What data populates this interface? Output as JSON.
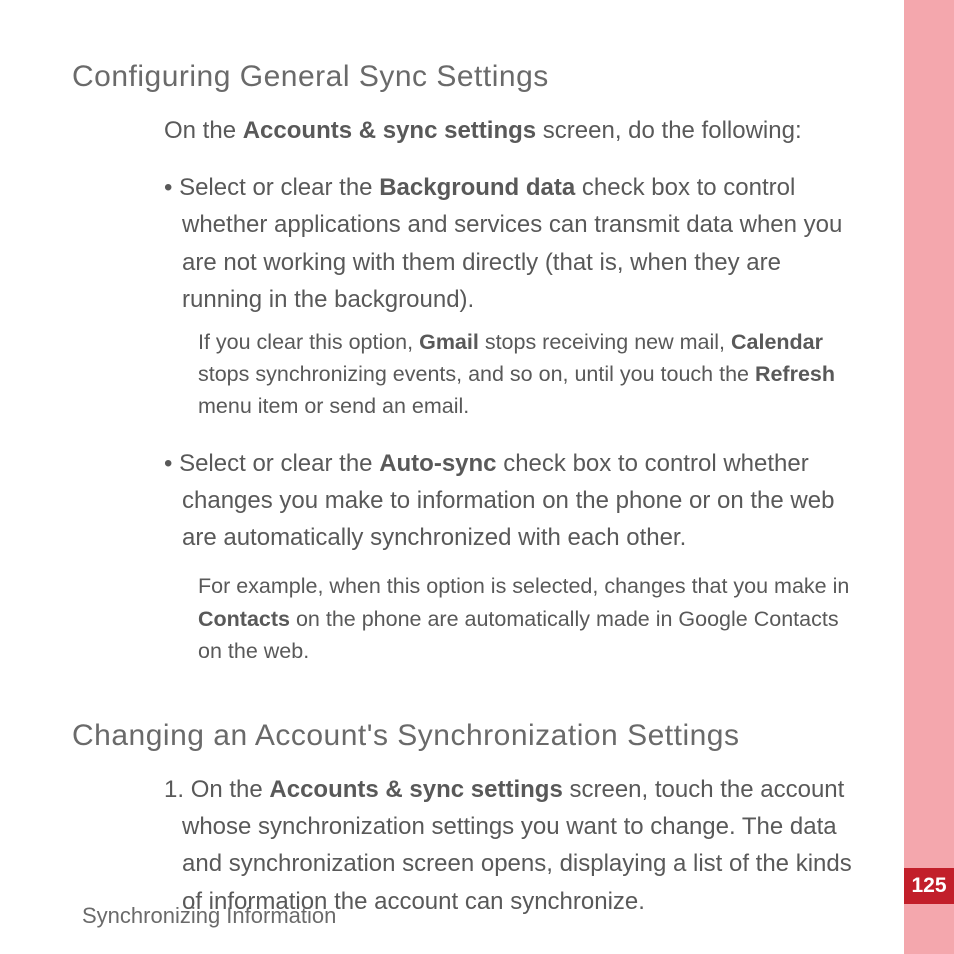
{
  "page_number": "125",
  "footer": "Synchronizing Information",
  "section1": {
    "heading": "Configuring General Sync Settings",
    "intro_pre": "On the ",
    "intro_bold": "Accounts & sync settings",
    "intro_post": " screen, do the following:",
    "item1": {
      "t1": "Select or clear the ",
      "b1": "Background data",
      "t2": " check box to control whether applications and services can transmit data when you are not working with them directly (that is, when they are running in the background).",
      "n1": "If you clear this option, ",
      "nb1": "Gmail",
      "n2": " stops receiving new mail, ",
      "nb2": "Calendar",
      "n3": " stops synchronizing events, and so on, until you touch the ",
      "nb3": "Refresh",
      "n4": " menu item or send an email."
    },
    "item2": {
      "t1": "Select or clear the ",
      "b1": "Auto-sync",
      "t2": " check box to control whether changes you make to information on the phone or on the web are automatically synchronized with each other.",
      "n1": "For example, when this option is selected, changes that you make in ",
      "nb1": "Contacts",
      "n2": " on the phone are automatically made in Google Contacts on the web."
    }
  },
  "section2": {
    "heading": "Changing an Account's Synchronization Settings",
    "step1": {
      "num": "1. ",
      "t1": "On the ",
      "b1": "Accounts & sync settings",
      "t2": " screen, touch the account whose synchronization settings you want to change. The data and synchronization screen opens, displaying a list of the kinds of information the account can synchronize."
    }
  }
}
